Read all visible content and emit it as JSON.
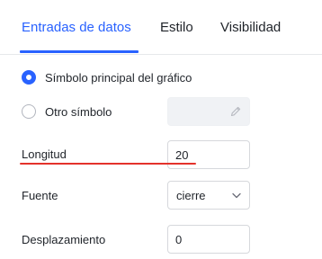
{
  "tabs": [
    {
      "label": "Entradas de datos",
      "active": true
    },
    {
      "label": "Estilo",
      "active": false
    },
    {
      "label": "Visibilidad",
      "active": false
    }
  ],
  "symbol_options": {
    "main": {
      "label": "Símbolo principal del gráfico",
      "checked": true
    },
    "other": {
      "label": "Otro símbolo",
      "checked": false
    }
  },
  "fields": {
    "length": {
      "label": "Longitud",
      "value": "20"
    },
    "source": {
      "label": "Fuente",
      "value": "cierre"
    },
    "offset": {
      "label": "Desplazamiento",
      "value": "0"
    }
  },
  "colors": {
    "accent": "#2962ff",
    "highlight_underline": "#e4322b"
  },
  "icons": {
    "symbol_edit": "pencil-icon",
    "source_dropdown": "chevron-down-icon"
  }
}
